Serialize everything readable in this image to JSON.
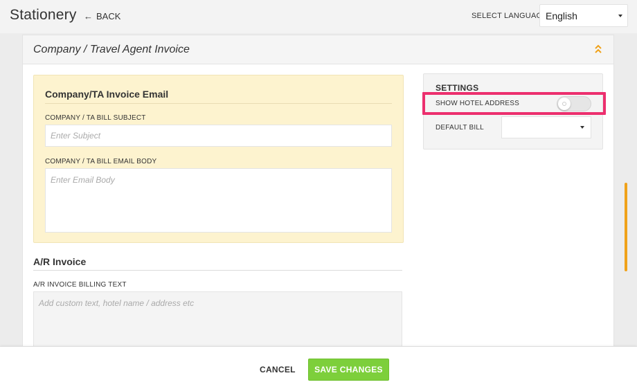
{
  "header": {
    "title": "Stationery",
    "back_label": "BACK",
    "language_label": "SELECT LANGUAGE",
    "language_value": "English"
  },
  "section": {
    "title": "Company / Travel Agent Invoice"
  },
  "email": {
    "title": "Company/TA Invoice Email",
    "subject_label": "COMPANY / TA BILL SUBJECT",
    "subject_placeholder": "Enter Subject",
    "body_label": "COMPANY / TA BILL EMAIL BODY",
    "body_placeholder": "Enter Email Body"
  },
  "ar": {
    "title": "A/R Invoice",
    "billing_label": "A/R INVOICE BILLING TEXT",
    "billing_placeholder": "Add custom text, hotel name / address etc"
  },
  "settings": {
    "title": "SETTINGS",
    "show_hotel_address_label": "SHOW HOTEL ADDRESS",
    "show_hotel_address_on": false,
    "default_bill_label": "DEFAULT BILL",
    "default_bill_value": ""
  },
  "footer": {
    "cancel_label": "CANCEL",
    "save_label": "SAVE CHANGES"
  },
  "colors": {
    "accent": "#f0a21a",
    "save": "#7dcf3b",
    "highlight": "#ec2f6e",
    "email_panel": "#fdf3cf"
  },
  "icons": {
    "back": "arrow-left-icon",
    "collapse": "double-chevron-up-icon",
    "select_caret": "caret-down-icon"
  }
}
